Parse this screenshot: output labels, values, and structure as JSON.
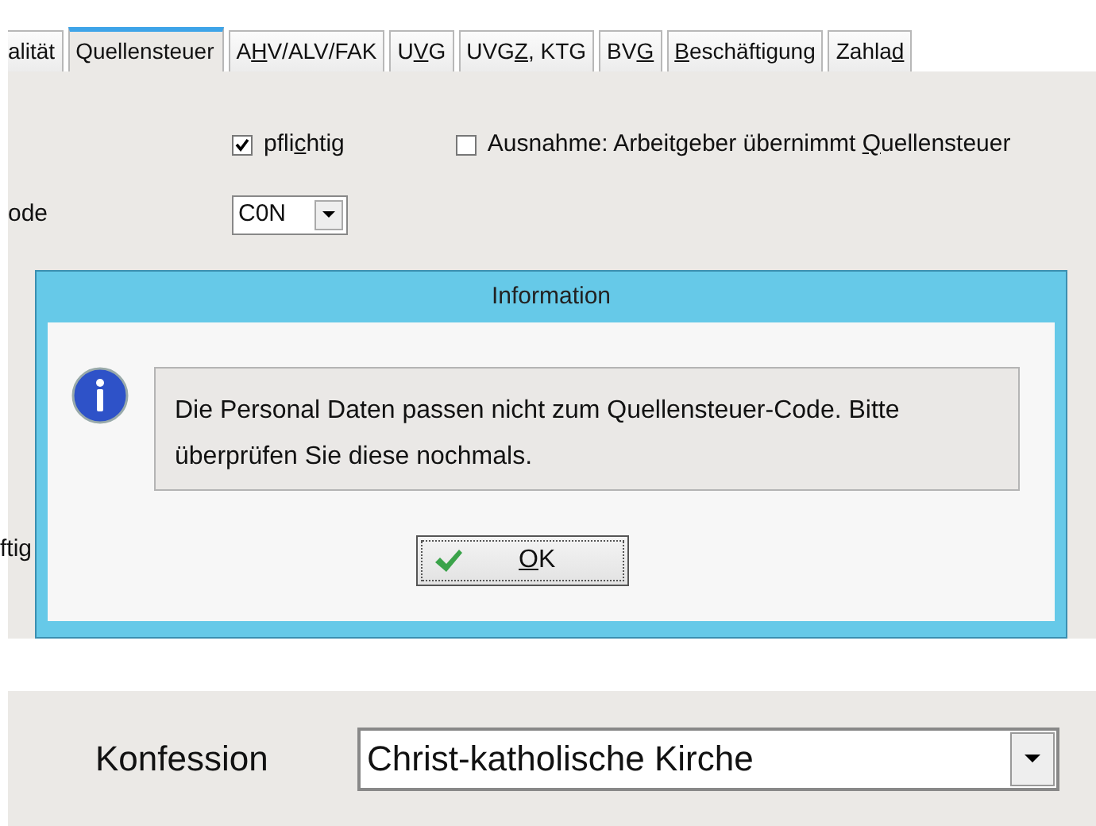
{
  "tabs": [
    {
      "selected": false,
      "segments": [
        {
          "text": "alität",
          "underlined": false
        }
      ]
    },
    {
      "selected": true,
      "segments": [
        {
          "text": "Quellensteuer",
          "underlined": false
        }
      ]
    },
    {
      "selected": false,
      "segments": [
        {
          "text": "A",
          "underlined": false
        },
        {
          "text": "H",
          "underlined": true
        },
        {
          "text": "V/ALV/FAK",
          "underlined": false
        }
      ]
    },
    {
      "selected": false,
      "segments": [
        {
          "text": "U",
          "underlined": false
        },
        {
          "text": "V",
          "underlined": true
        },
        {
          "text": "G",
          "underlined": false
        }
      ]
    },
    {
      "selected": false,
      "segments": [
        {
          "text": "UVG",
          "underlined": false
        },
        {
          "text": "Z",
          "underlined": true
        },
        {
          "text": ", KTG",
          "underlined": false
        }
      ]
    },
    {
      "selected": false,
      "segments": [
        {
          "text": "BV",
          "underlined": false
        },
        {
          "text": "G",
          "underlined": true
        }
      ]
    },
    {
      "selected": false,
      "segments": [
        {
          "text": "B",
          "underlined": true
        },
        {
          "text": "eschäftigung",
          "underlined": false
        }
      ]
    },
    {
      "selected": false,
      "segments": [
        {
          "text": "Zahla",
          "underlined": false
        },
        {
          "text": "d",
          "underlined": true
        }
      ]
    }
  ],
  "checkboxes": [
    {
      "checked": true,
      "segments": [
        {
          "text": "pfli",
          "underlined": false
        },
        {
          "text": "c",
          "underlined": true
        },
        {
          "text": "htig",
          "underlined": false
        }
      ]
    },
    {
      "checked": false,
      "segments": [
        {
          "text": "Ausnahme: Arbeitgeber übernimmt ",
          "underlined": false
        },
        {
          "text": "Q",
          "underlined": true
        },
        {
          "text": "uellensteuer",
          "underlined": false
        }
      ]
    }
  ],
  "code_field": {
    "label": "ode",
    "value": "C0N"
  },
  "hidden_label": "ftig",
  "dialog": {
    "title": "Information",
    "message": "Die Personal Daten passen nicht zum Quellensteuer-Code. Bitte überprüfen Sie diese nochmals.",
    "ok_button": [
      {
        "text": "O",
        "underlined": true
      },
      {
        "text": "K",
        "underlined": false
      }
    ]
  },
  "konfession": {
    "label": "Konfession",
    "value": "Christ-katholische Kirche"
  }
}
